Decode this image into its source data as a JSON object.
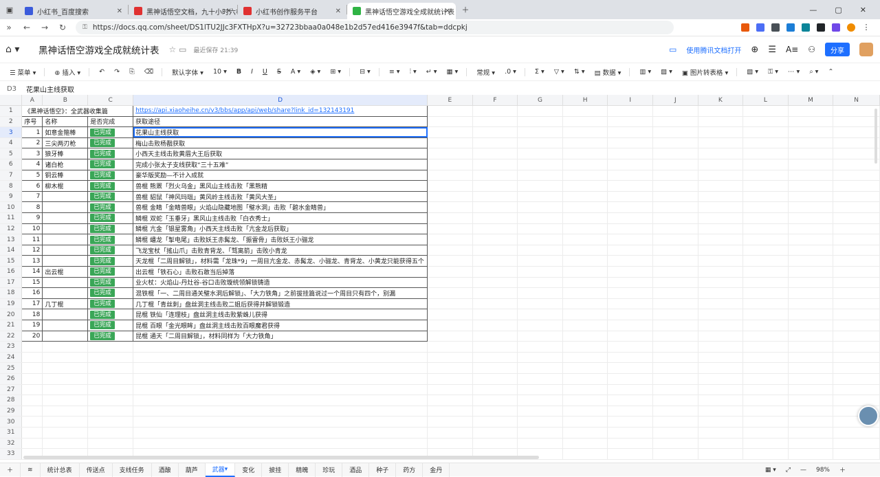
{
  "browser": {
    "tabs": [
      {
        "label": "小红书_百度搜索",
        "color": "#3b5bdb",
        "active": false
      },
      {
        "label": "黑神话悟空文档，九十小时六根",
        "color": "#e03131",
        "active": false
      },
      {
        "label": "小红书创作服务平台",
        "color": "#e03131",
        "active": false
      },
      {
        "label": "黑神话悟空游戏全成就统计表",
        "color": "#2fb344",
        "active": true
      }
    ],
    "url": "https://docs.qq.com/sheet/DS1lTU2JJc3FXTHpX?u=32723bbaa0a048e1b2d57ed416e3947f&tab=ddcpkj"
  },
  "doc": {
    "title": "黑神话悟空游戏全成就统计表",
    "saved": "最近保存 21:39",
    "open_in_app": "使用腾讯文档打开",
    "share": "分享"
  },
  "toolbar": {
    "menu": "菜单",
    "insert": "插入",
    "font": "默认字体",
    "size": "10",
    "format": "常规",
    "data": "数据",
    "image_table": "图片转表格"
  },
  "formula": {
    "ref": "D3",
    "value": "花果山主线获取"
  },
  "columns": [
    "A",
    "B",
    "C",
    "D",
    "E",
    "F",
    "G",
    "H",
    "I",
    "J",
    "K",
    "L",
    "M",
    "N"
  ],
  "rows": [
    {
      "a": "《黑神话悟空》：全武器收集篇",
      "b": "",
      "c": "",
      "d": "https://api.xiaoheihe.cn/v3/bbs/app/api/web/share?link_id=132143191",
      "link": true
    },
    {
      "a": "序号",
      "b": "名称",
      "c": "是否完成",
      "d": "获取途径"
    },
    {
      "a": "1",
      "b": "如意金箍棒",
      "c": "已完成",
      "d": "花果山主线获取"
    },
    {
      "a": "2",
      "b": "三尖两刃枪",
      "c": "已完成",
      "d": "梅山击败杨戬获取"
    },
    {
      "a": "3",
      "b": "狼牙棒",
      "c": "已完成",
      "d": "小西天主线击败黄眉大王后获取"
    },
    {
      "a": "4",
      "b": "诸白枪",
      "c": "已完成",
      "d": "完成小张太子支线获取“三十五难”"
    },
    {
      "a": "5",
      "b": "铜云棒",
      "c": "已完成",
      "d": "豪华版奖励—不计入成就"
    },
    {
      "a": "6",
      "b": "柳木棍",
      "c": "已完成",
      "d": "兽棍 熊罴「烈火乌金」黑风山主线击败「黑熊精"
    },
    {
      "a": "7",
      "b": "",
      "c": "已完成",
      "d": "兽棍 貂鼠「神风玛瑙」黄风岭主线击败「黄风大圣」"
    },
    {
      "a": "8",
      "b": "",
      "c": "已完成",
      "d": "兽棍 金睛「金睛兽眼」火焰山隐藏地图「璧水洞」击败「碧水金睛兽」"
    },
    {
      "a": "9",
      "b": "",
      "c": "已完成",
      "d": "鳞棍 双蛇「玉垂牙」黑风山主线击败「白衣秀士」"
    },
    {
      "a": "10",
      "b": "",
      "c": "已完成",
      "d": "鳞棍 亢金「银星雾角」小西天主线击败「亢金龙后获取」"
    },
    {
      "a": "11",
      "b": "",
      "c": "已完成",
      "d": "鳞棍 蟠龙「掣电尾」击败妖王赤髯龙、「振雷骨」击败妖王小骊龙"
    },
    {
      "a": "12",
      "b": "",
      "c": "已完成",
      "d": "飞龙宝杖「搖山爪」击败青背龙、「骛离箭」击败小青龙"
    },
    {
      "a": "13",
      "b": "",
      "c": "已完成",
      "d": "天龙棍「二周目解锁」，材料需「龙珠*9」一周目亢金龙、赤髯龙、小骊龙、青背龙、小黄龙只能获得五个"
    },
    {
      "a": "14",
      "b": "出云棍",
      "c": "已完成",
      "d": "出云棍「铁石心」击败石敢当后掉落"
    },
    {
      "a": "15",
      "b": "",
      "c": "已完成",
      "d": "业火杖：火焰山-丹灶谷-谷口击败璇统领解锁铸造"
    },
    {
      "a": "16",
      "b": "",
      "c": "已完成",
      "d": "混铁棍「一、二周目通关璧水洞后解锁」、「大力铁角」之前拔挂篇说过一个周目只有四个，别漏"
    },
    {
      "a": "17",
      "b": "几丁棍",
      "c": "已完成",
      "d": "几丁棍「青丝刺」盘丝洞主线击败二姐后获得并解锁锻造"
    },
    {
      "a": "18",
      "b": "",
      "c": "已完成",
      "d": "昆棍 铁仙「连理枝」盘丝洞主线击败紫蛛儿获得"
    },
    {
      "a": "19",
      "b": "",
      "c": "已完成",
      "d": "昆棍 百眼「金光眼眸」盘丝洞主线击败百眼魔君获得"
    },
    {
      "a": "20",
      "b": "",
      "c": "已完成",
      "d": "昆棍 通天「二周目解锁」，材料同样为「大力铁角」"
    }
  ],
  "row_numbers": [
    "1",
    "2",
    "3",
    "4",
    "5",
    "6",
    "7",
    "8",
    "9",
    "10",
    "11",
    "12",
    "13",
    "14",
    "15",
    "16",
    "17",
    "18",
    "19",
    "20",
    "21",
    "22",
    "23",
    "24",
    "25",
    "26",
    "27",
    "28",
    "29",
    "30",
    "31",
    "32",
    "33"
  ],
  "sheets": [
    "统计总表",
    "传送点",
    "支线任务",
    "酒酿",
    "葫芦",
    "武器",
    "变化",
    "披挂",
    "精魄",
    "珍玩",
    "酒品",
    "种子",
    "药方",
    "金丹"
  ],
  "active_sheet": "武器",
  "zoom": "98%"
}
